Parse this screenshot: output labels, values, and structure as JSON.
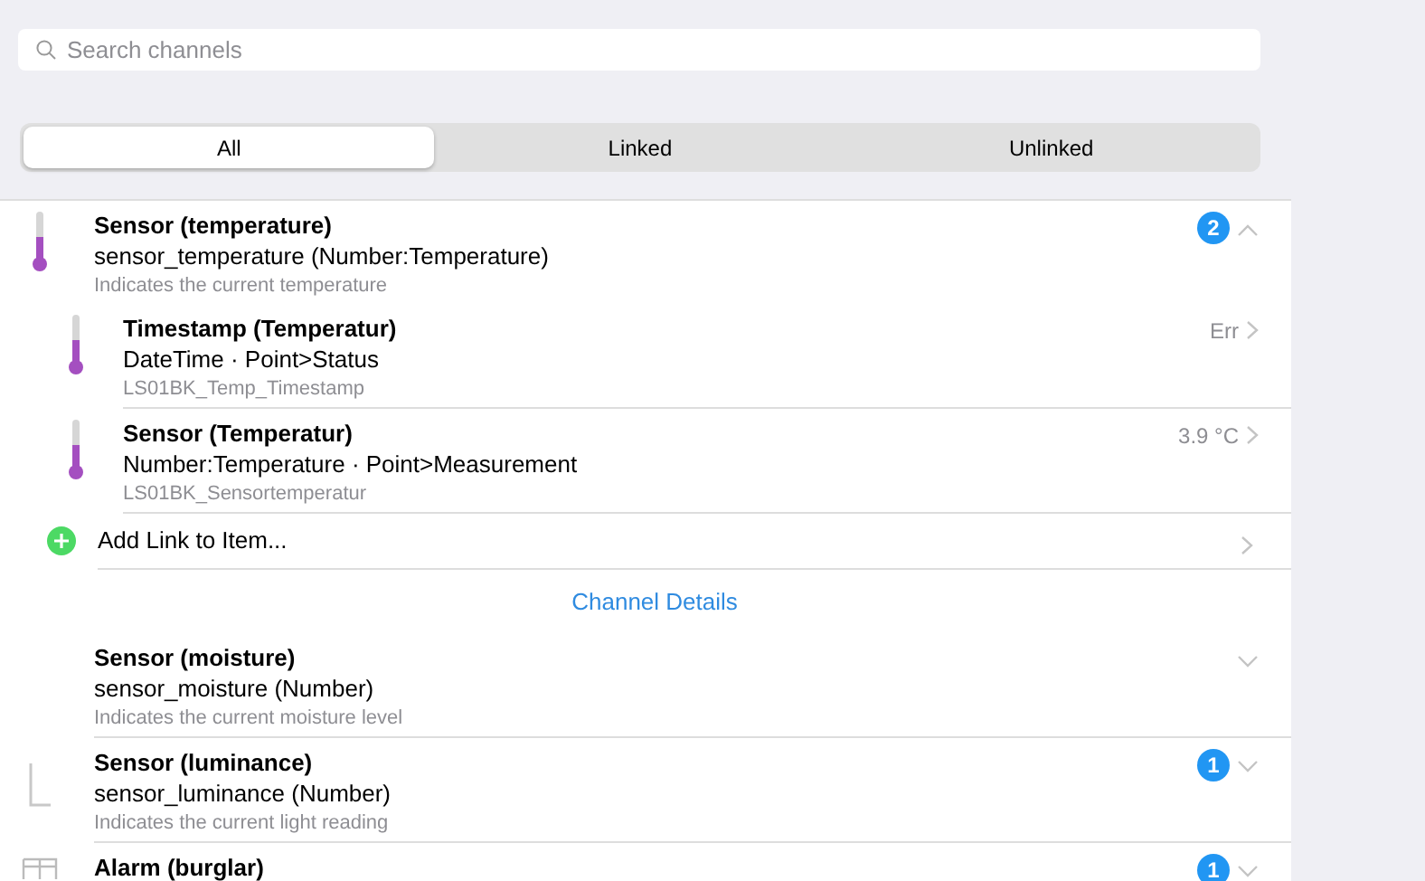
{
  "search": {
    "placeholder": "Search channels"
  },
  "tabs": [
    {
      "label": "All",
      "selected": true
    },
    {
      "label": "Linked",
      "selected": false
    },
    {
      "label": "Unlinked",
      "selected": false
    }
  ],
  "channels": [
    {
      "kind": "temperature",
      "title": "Sensor (temperature)",
      "subtitle": "sensor_temperature (Number:Temperature)",
      "description": "Indicates the current temperature",
      "badge": "2",
      "expanded": true,
      "links": [
        {
          "kind": "temperature",
          "title": "Timestamp (Temperatur)",
          "subtitle": "DateTime · Point>Status",
          "item": "LS01BK_Temp_Timestamp",
          "state": "Err"
        },
        {
          "kind": "temperature",
          "title": "Sensor (Temperatur)",
          "subtitle": "Number:Temperature · Point>Measurement",
          "item": "LS01BK_Sensortemperatur",
          "state": "3.9 °C"
        }
      ],
      "add_link": "Add Link to Item...",
      "details_link": "Channel Details"
    },
    {
      "kind": "none",
      "title": "Sensor (moisture)",
      "subtitle": "sensor_moisture (Number)",
      "description": "Indicates the current moisture level",
      "expanded": false
    },
    {
      "kind": "luminance",
      "title": "Sensor (luminance)",
      "subtitle": "sensor_luminance (Number)",
      "description": "Indicates the current light reading",
      "badge": "1",
      "expanded": false
    },
    {
      "kind": "alarm",
      "title": "Alarm (burglar)",
      "badge": "1",
      "expanded": false
    }
  ]
}
